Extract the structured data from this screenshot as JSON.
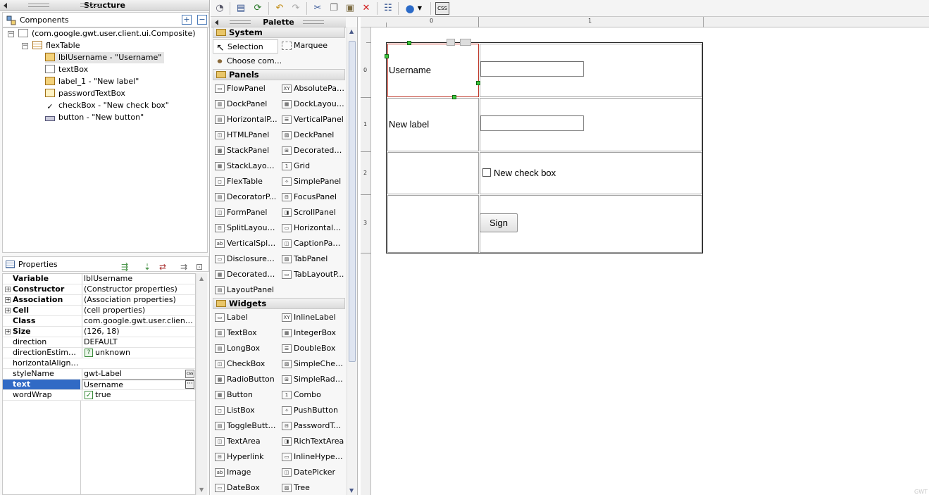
{
  "structure": {
    "title": "Structure",
    "components_label": "Components",
    "tree": [
      {
        "label": "(com.google.gwt.user.client.ui.Composite)"
      },
      {
        "label": "flexTable"
      },
      {
        "label": "lblUsername - \"Username\""
      },
      {
        "label": "textBox"
      },
      {
        "label": "label_1 - \"New label\""
      },
      {
        "label": "passwordTextBox"
      },
      {
        "label": "checkBox - \"New check box\""
      },
      {
        "label": "button - \"New button\""
      }
    ]
  },
  "properties": {
    "title": "Properties",
    "rows": [
      {
        "name": "Variable",
        "value": "lblUsername"
      },
      {
        "name": "Constructor",
        "value": "(Constructor properties)"
      },
      {
        "name": "Association",
        "value": "(Association properties)"
      },
      {
        "name": "Cell",
        "value": "(cell properties)"
      },
      {
        "name": "Class",
        "value": "com.google.gwt.user.client.ui...."
      },
      {
        "name": "Size",
        "value": "(126, 18)"
      },
      {
        "name": "direction",
        "value": "DEFAULT"
      },
      {
        "name": "directionEstimato...",
        "value": "unknown"
      },
      {
        "name": "horizontalAlignment",
        "value": ""
      },
      {
        "name": "styleName",
        "value": "gwt-Label"
      },
      {
        "name": "text",
        "value": "Username"
      },
      {
        "name": "wordWrap",
        "value": "true"
      }
    ]
  },
  "palette": {
    "title": "Palette",
    "categories": {
      "system": "System",
      "panels": "Panels",
      "widgets": "Widgets"
    },
    "system_items": [
      "Selection",
      "Marquee",
      "Choose com..."
    ],
    "panel_items": [
      "FlowPanel",
      "AbsolutePanel",
      "DockPanel",
      "DockLayout...",
      "HorizontalP...",
      "VerticalPanel",
      "HTMLPanel",
      "DeckPanel",
      "StackPanel",
      "DecoratedS...",
      "StackLayou...",
      "Grid",
      "FlexTable",
      "SimplePanel",
      "DecoratorP...",
      "FocusPanel",
      "FormPanel",
      "ScrollPanel",
      "SplitLayout...",
      "HorizontalS...",
      "VerticalSplit...",
      "CaptionPanel",
      "DisclosureP...",
      "TabPanel",
      "DecoratedT...",
      "TabLayoutP...",
      "LayoutPanel"
    ],
    "widget_items": [
      "Label",
      "InlineLabel",
      "TextBox",
      "IntegerBox",
      "LongBox",
      "DoubleBox",
      "CheckBox",
      "SimpleChec...",
      "RadioButton",
      "SimpleRadio...",
      "Button",
      "Combo",
      "ListBox",
      "PushButton",
      "ToggleButton",
      "PasswordTe...",
      "TextArea",
      "RichTextArea",
      "Hyperlink",
      "InlineHyperlink",
      "Image",
      "DatePicker",
      "DateBox",
      "Tree"
    ]
  },
  "canvas": {
    "col_headers": [
      "0",
      "1"
    ],
    "row_headers": [
      "0",
      "1",
      "2",
      "3"
    ],
    "username_label": "Username",
    "new_label": "New label",
    "checkbox_label": "New check box",
    "button_label": "Sign",
    "watermark": "GWT"
  },
  "colors": {
    "selection": "#316ac5",
    "handle": "#3fc63f",
    "selected_border": "#c0392b"
  }
}
